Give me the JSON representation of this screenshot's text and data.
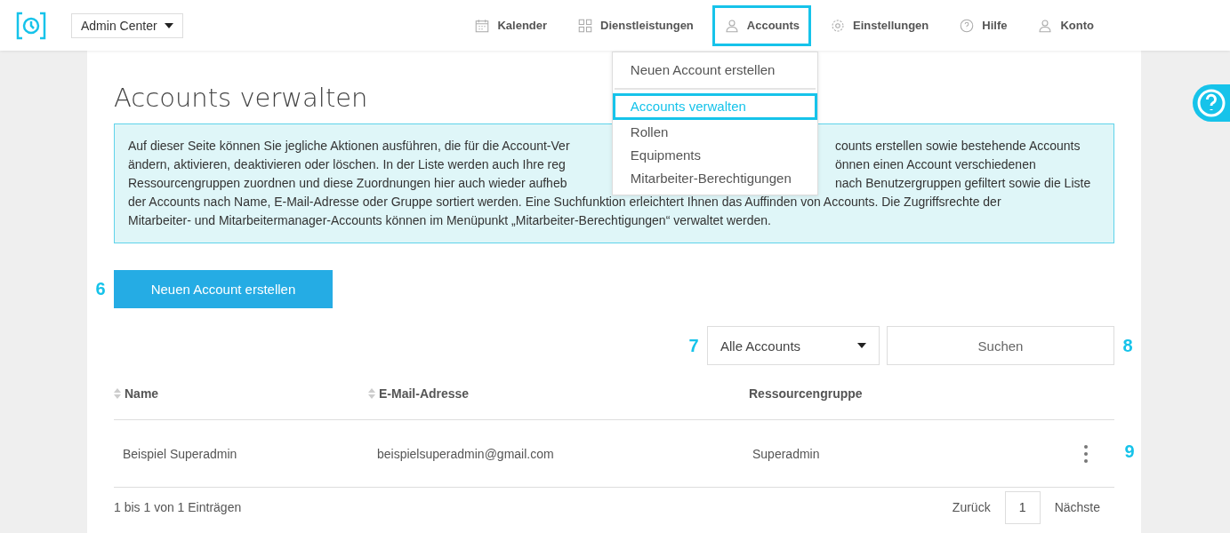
{
  "header": {
    "app_switcher": "Admin Center",
    "nav": [
      {
        "label": "Kalender",
        "selected": false
      },
      {
        "label": "Dienstleistungen",
        "selected": false
      },
      {
        "label": "Accounts",
        "selected": true
      },
      {
        "label": "Einstellungen",
        "selected": false
      },
      {
        "label": "Hilfe",
        "selected": false
      },
      {
        "label": "Konto",
        "selected": false
      }
    ]
  },
  "menu": {
    "groups": [
      [
        {
          "label": "Neuen Account erstellen",
          "selected": false
        }
      ],
      [
        {
          "label": "Accounts verwalten",
          "selected": true
        },
        {
          "label": "Rollen",
          "selected": false
        },
        {
          "label": "Equipments",
          "selected": false
        },
        {
          "label": "Mitarbeiter-Berechtigungen",
          "selected": false
        }
      ]
    ]
  },
  "page": {
    "title": "Accounts verwalten",
    "info_lines": [
      {
        "left": "Auf dieser Seite können Sie jegliche Aktionen ausführen, die für die Account-Ver",
        "right": "counts erstellen sowie bestehende Accounts"
      },
      {
        "left": "ändern, aktivieren, deaktivieren oder löschen. In der Liste werden auch Ihre reg",
        "right": "önnen einen Account verschiedenen"
      },
      {
        "left": "Ressourcengruppen zuordnen und diese Zuordnungen hier auch wieder aufheb",
        "right": "nach Benutzergruppen gefiltert sowie die Liste"
      },
      {
        "left": "der Accounts nach Name, E-Mail-Adresse oder Gruppe sortiert werden. Eine Suchfunktion erleichtert Ihnen das Auffinden von Accounts. Die Zugriffsrechte der"
      },
      {
        "left": "Mitarbeiter- und Mitarbeitermanager-Accounts können im Menüpunkt „Mitarbeiter-Berechtigungen“ verwaltet werden."
      }
    ],
    "create_button": {
      "label": "Neuen Account erstellen",
      "marker": "6"
    },
    "filter": {
      "value": "Alle Accounts",
      "marker": "7"
    },
    "search": {
      "placeholder": "Suchen",
      "marker": "8"
    },
    "table": {
      "columns": [
        {
          "label": "Name",
          "sortable": true
        },
        {
          "label": "E-Mail-Adresse",
          "sortable": true
        },
        {
          "label": "Ressourcengruppe",
          "sortable": false
        }
      ],
      "rows": [
        {
          "cells": [
            "Beispiel Superadmin",
            "beispielsuperadmin@gmail.com",
            "Superadmin"
          ],
          "marker": "9"
        }
      ]
    },
    "summary": "1 bis 1 von 1 Einträgen",
    "pagination": {
      "previous": "Zurück",
      "page": "1",
      "next": "Nächste"
    }
  }
}
